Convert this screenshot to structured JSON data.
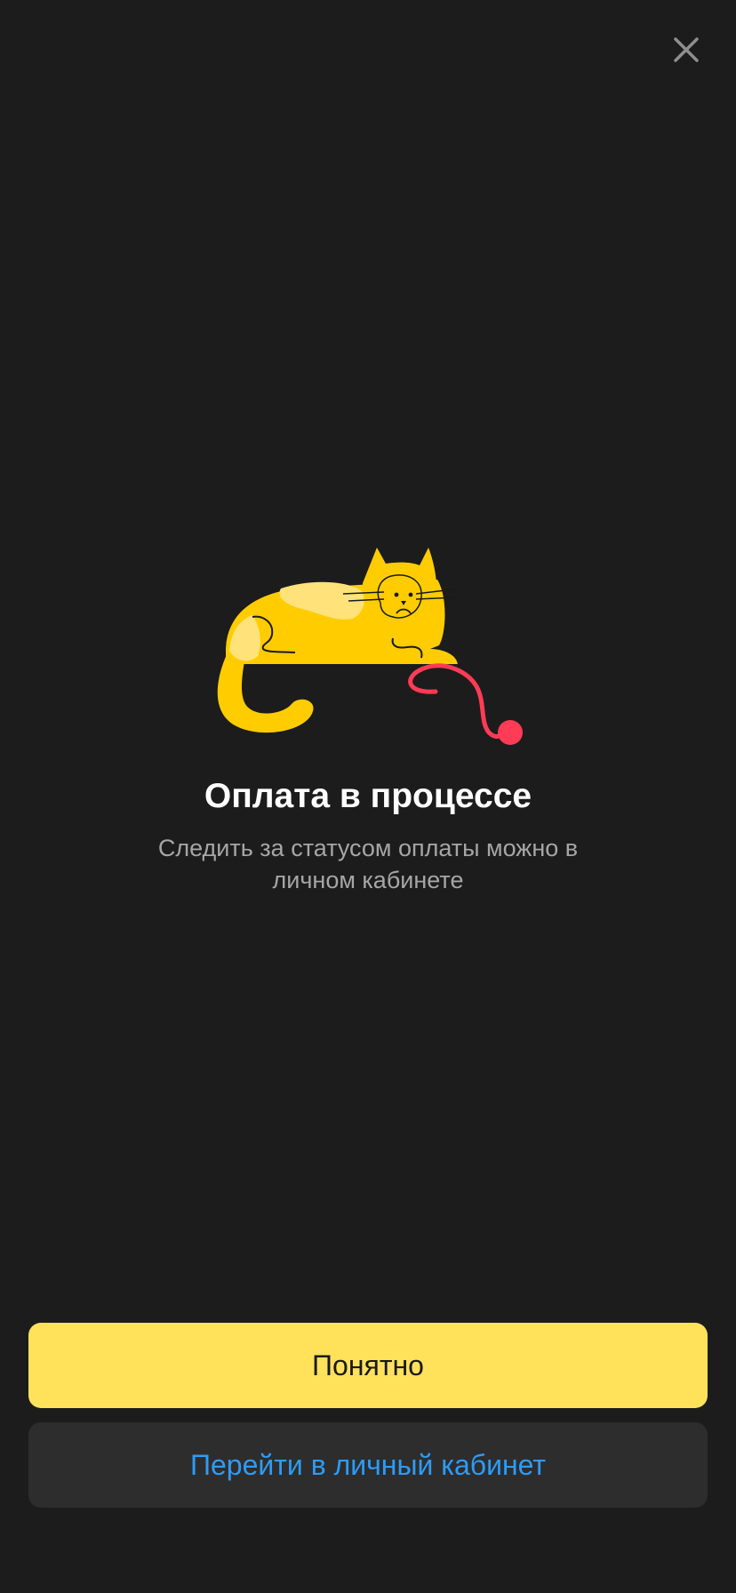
{
  "dialog": {
    "close_icon": "close-icon",
    "illustration": "cat-with-yarn-illustration",
    "title": "Оплата в процессе",
    "subtitle": "Следить за статусом оплаты можно в личном кабинете"
  },
  "actions": {
    "primary_label": "Понятно",
    "secondary_label": "Перейти в личный кабинет"
  },
  "colors": {
    "background": "#1c1c1c",
    "primary_button": "#ffe25a",
    "secondary_button": "#2d2d2d",
    "link_text": "#2e9bf5",
    "cat_body": "#ffcc00",
    "cat_patch": "#ffe27a",
    "yarn": "#ff3b55"
  }
}
